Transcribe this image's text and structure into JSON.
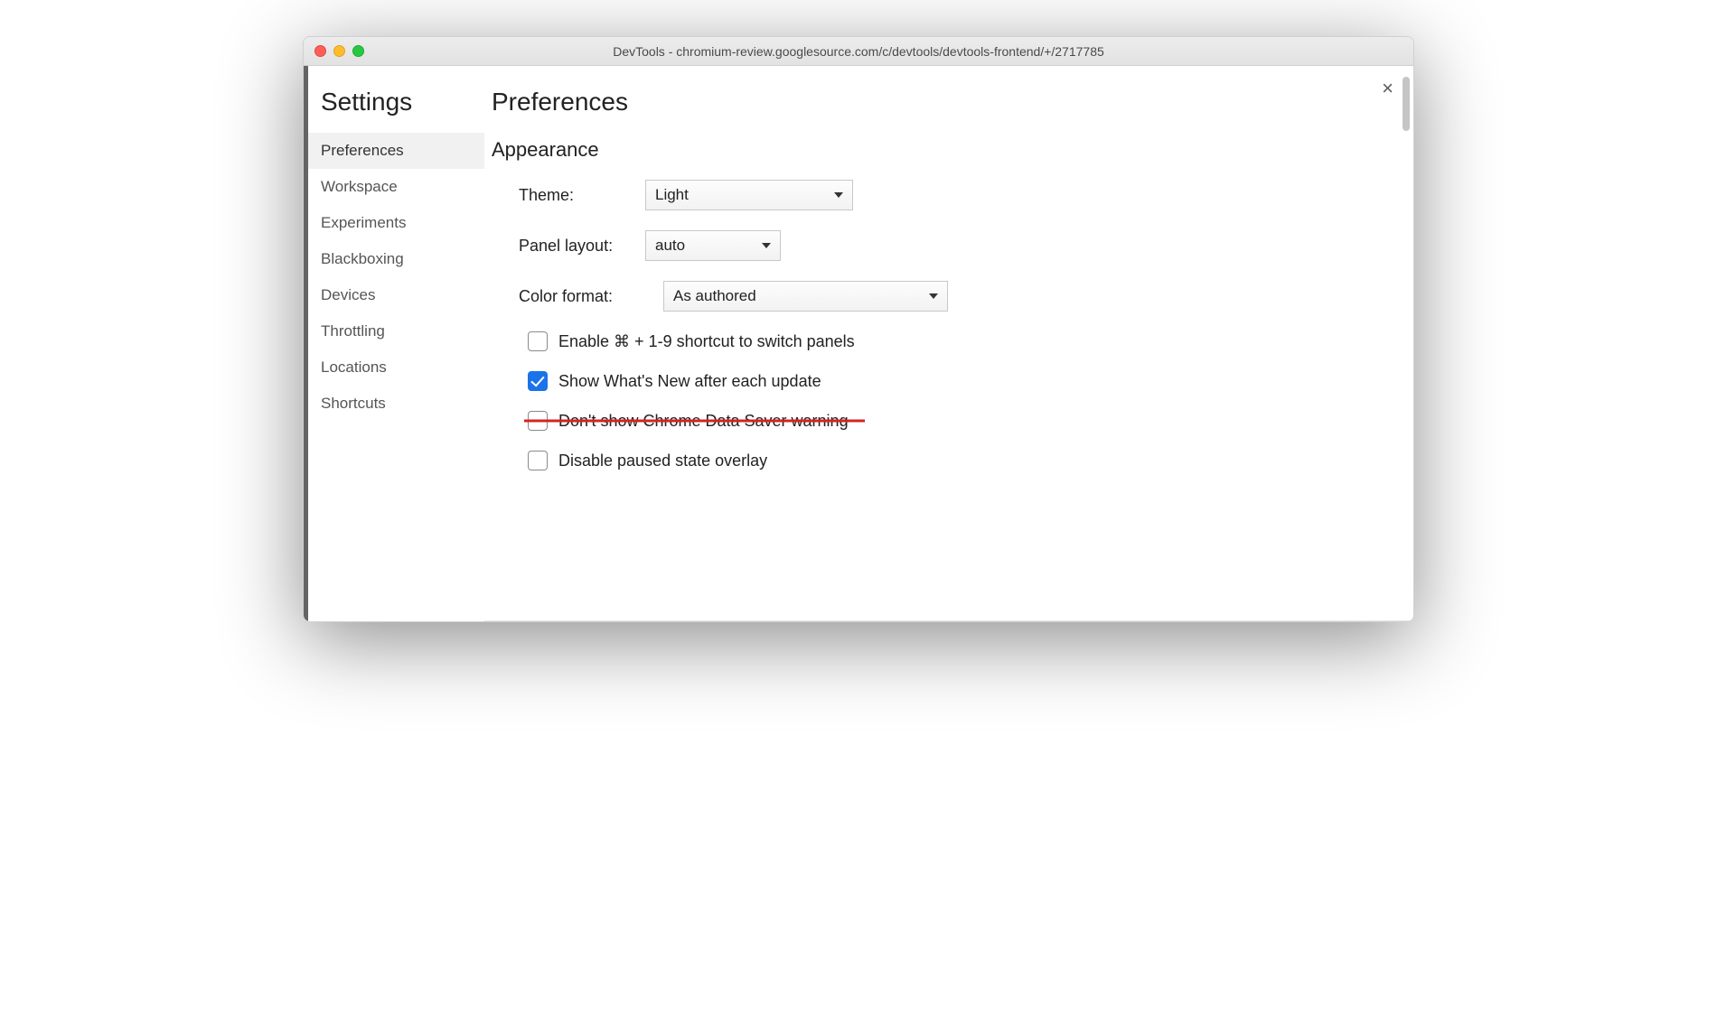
{
  "window": {
    "title": "DevTools - chromium-review.googlesource.com/c/devtools/devtools-frontend/+/2717785"
  },
  "sidebar": {
    "title": "Settings",
    "items": [
      {
        "label": "Preferences",
        "active": true
      },
      {
        "label": "Workspace",
        "active": false
      },
      {
        "label": "Experiments",
        "active": false
      },
      {
        "label": "Blackboxing",
        "active": false
      },
      {
        "label": "Devices",
        "active": false
      },
      {
        "label": "Throttling",
        "active": false
      },
      {
        "label": "Locations",
        "active": false
      },
      {
        "label": "Shortcuts",
        "active": false
      }
    ]
  },
  "main": {
    "title": "Preferences",
    "section_title": "Appearance",
    "theme": {
      "label": "Theme:",
      "value": "Light"
    },
    "panel_layout": {
      "label": "Panel layout:",
      "value": "auto"
    },
    "color_format": {
      "label": "Color format:",
      "value": "As authored"
    },
    "checks": [
      {
        "label": "Enable ⌘ + 1-9 shortcut to switch panels",
        "checked": false,
        "struck": false
      },
      {
        "label": "Show What's New after each update",
        "checked": true,
        "struck": false
      },
      {
        "label": "Don't show Chrome Data Saver warning",
        "checked": false,
        "struck": true
      },
      {
        "label": "Disable paused state overlay",
        "checked": false,
        "struck": false
      }
    ]
  }
}
